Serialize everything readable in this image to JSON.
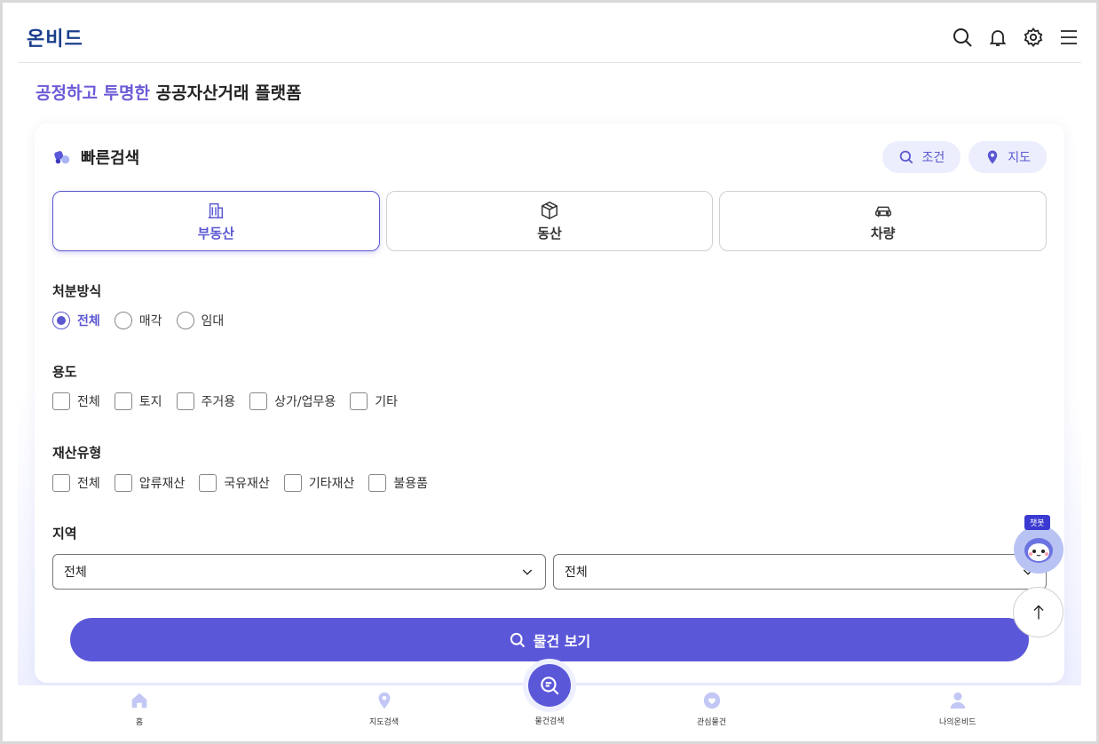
{
  "header": {
    "logo": "온비드",
    "icons": [
      "search-icon",
      "bell-icon",
      "gear-icon",
      "menu-icon"
    ]
  },
  "tagline": {
    "accent": "공정하고 투명한",
    "rest": "공공자산거래 플랫폼"
  },
  "quick_search": {
    "title": "빠른검색",
    "pill_condition": "조건",
    "pill_map": "지도",
    "tabs": [
      {
        "label": "부동산",
        "icon": "building-icon",
        "active": true
      },
      {
        "label": "동산",
        "icon": "box-icon",
        "active": false
      },
      {
        "label": "차량",
        "icon": "car-icon",
        "active": false
      }
    ]
  },
  "disposal": {
    "label": "처분방식",
    "options": [
      "전체",
      "매각",
      "임대"
    ],
    "selected": "전체"
  },
  "usage": {
    "label": "용도",
    "options": [
      "전체",
      "토지",
      "주거용",
      "상가/업무용",
      "기타"
    ]
  },
  "property_type": {
    "label": "재산유형",
    "options": [
      "전체",
      "압류재산",
      "국유재산",
      "기타재산",
      "불용품"
    ]
  },
  "region": {
    "label": "지역",
    "select1": "전체",
    "select2": "전체"
  },
  "search_button": "물건 보기",
  "chatbot": {
    "tag": "챗봇"
  },
  "bottom_nav": {
    "home": "홈",
    "map": "지도검색",
    "search": "물건검색",
    "favorites": "관심물건",
    "my": "나의온비드"
  },
  "colors": {
    "accent": "#5b57d9",
    "logo": "#1a3e8c",
    "pill_bg": "#eceefd"
  }
}
